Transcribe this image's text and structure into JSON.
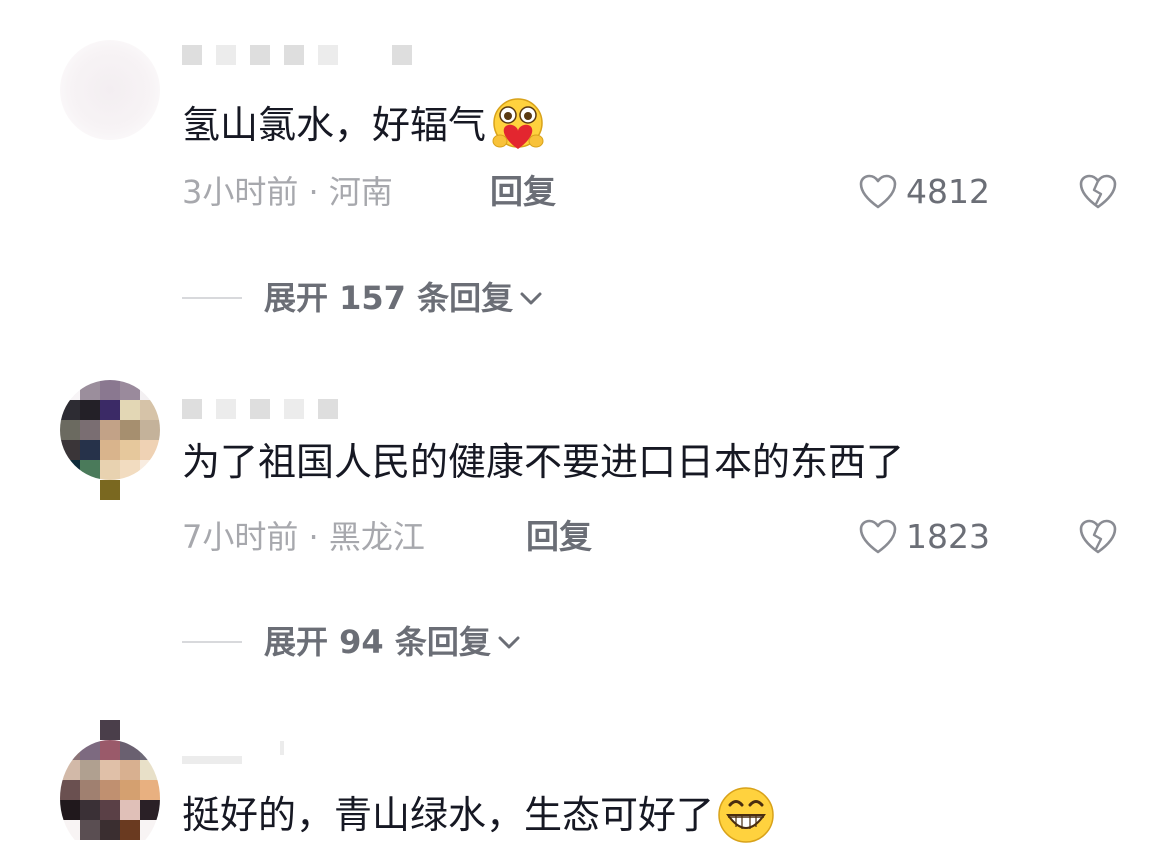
{
  "comments": [
    {
      "text": "氢山氯水，好辐气",
      "emoji": "heart-hug-emoji",
      "time": "3小时前",
      "separator": "·",
      "location": "河南",
      "reply_label": "回复",
      "likes": "4812",
      "expand_label": "展开 157 条回复"
    },
    {
      "text": "为了祖国人民的健康不要进口日本的东西了",
      "time": "7小时前",
      "separator": "·",
      "location": "黑龙江",
      "reply_label": "回复",
      "likes": "1823",
      "expand_label": "展开 94 条回复"
    },
    {
      "text": "挺好的，青山绿水，生态可好了",
      "emoji": "grin-emoji"
    }
  ],
  "icons": {
    "like": "heart-outline-icon",
    "dislike": "broken-heart-icon",
    "expand": "chevron-down-icon"
  },
  "colors": {
    "text": "#161823",
    "meta": "#a7a8ad",
    "action": "#6b6e76"
  }
}
